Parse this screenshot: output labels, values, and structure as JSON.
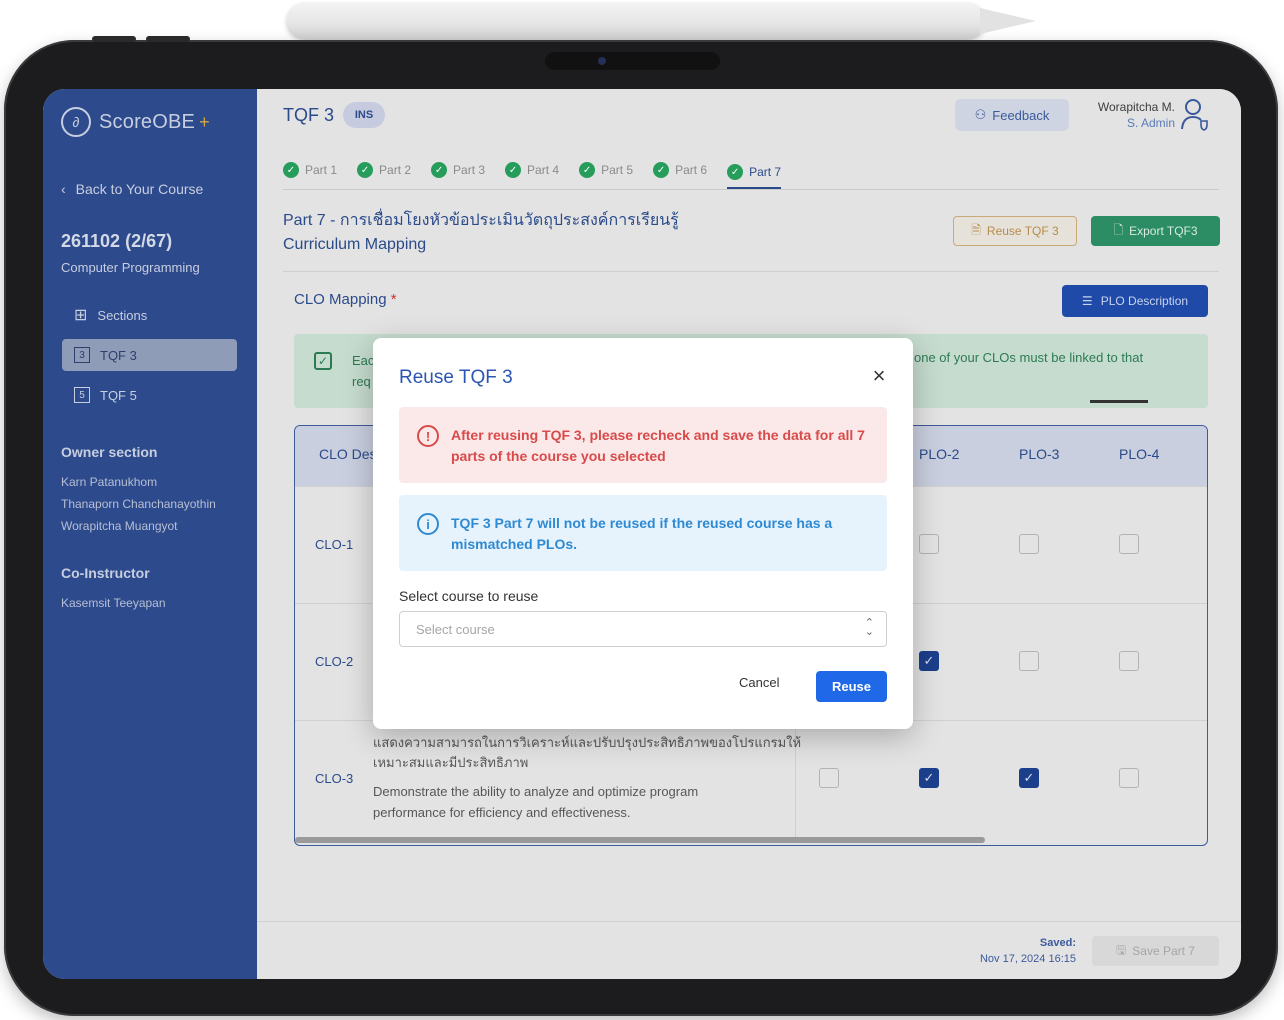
{
  "sidebar": {
    "logo": "ScoreOBE",
    "logo_plus": "+",
    "back": "Back to Your Course",
    "course_code": "261102 (2/67)",
    "course_name": "Computer Programming",
    "nav": [
      {
        "box": "",
        "label": "Sections",
        "icon": "grid-icon"
      },
      {
        "box": "3",
        "label": "TQF 3"
      },
      {
        "box": "5",
        "label": "TQF 5"
      }
    ],
    "owner_heading": "Owner section",
    "owners": [
      "Karn Patanukhom",
      "Thanaporn Chanchanayothin",
      "Worapitcha Muangyot"
    ],
    "coinstructor_heading": "Co-Instructor",
    "coinstructors": [
      "Kasemsit Teeyapan"
    ]
  },
  "header": {
    "title": "TQF 3",
    "badge": "INS",
    "feedback": "Feedback",
    "user_name": "Worapitcha M.",
    "user_role": "S. Admin"
  },
  "steps": [
    "Part 1",
    "Part 2",
    "Part 3",
    "Part 4",
    "Part 5",
    "Part 6",
    "Part 7"
  ],
  "part": {
    "title_th": "Part 7 - การเชื่อมโยงหัวข้อประเมินวัตถุประสงค์การเรียนรู้",
    "title_en": "Curriculum Mapping",
    "reuse_button": "Reuse TQF 3",
    "export_button": "Export TQF3"
  },
  "mapping": {
    "heading": "CLO Mapping",
    "required_mark": "*",
    "plo_desc_button": "PLO Description",
    "note_left_1": "Eac",
    "note_left_2": "req",
    "note_right": "one of your CLOs must be linked to that",
    "columns": [
      "CLO Des",
      "PLO-2",
      "PLO-3",
      "PLO-4"
    ],
    "rows": [
      {
        "clo": "CLO-1",
        "desc_th": "",
        "desc_en": "",
        "checks": [
          false,
          false,
          false
        ]
      },
      {
        "clo": "CLO-2",
        "desc_th": "",
        "desc_en": "",
        "checks": [
          true,
          false,
          false
        ]
      },
      {
        "clo": "CLO-3",
        "desc_th_1": "แสดงความสามารถในการวิเคราะห์และปรับปรุงประสิทธิภาพของโปรแกรมให้",
        "desc_th_2": "เหมาะสมและมีประสิทธิภาพ",
        "desc_en_1": "Demonstrate the ability to analyze and optimize program",
        "desc_en_2": "performance for efficiency and effectiveness.",
        "checks": [
          false,
          true,
          true,
          false
        ]
      }
    ]
  },
  "footer": {
    "saved_label": "Saved:",
    "saved_date": "Nov 17, 2024 16:15",
    "save_button": "Save Part 7"
  },
  "modal": {
    "title": "Reuse TQF 3",
    "alert_error": "After reusing TQF 3, please recheck and save the data for all 7 parts of the course you selected",
    "alert_info": "TQF 3 Part 7 will not be reused if the reused course has a mismatched PLOs.",
    "select_label": "Select course to reuse",
    "select_placeholder": "Select course",
    "cancel": "Cancel",
    "reuse": "Reuse"
  }
}
